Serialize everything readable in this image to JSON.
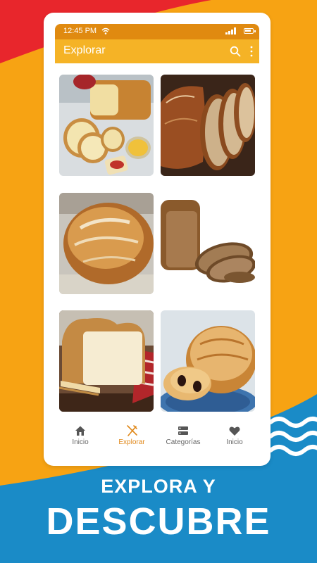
{
  "colors": {
    "background": "#f7a313",
    "red_corner": "#e8262c",
    "blue_band": "#1a8bc7",
    "statusbar": "#e08a10",
    "appbar": "#f5b326",
    "active_nav": "#e0881a"
  },
  "statusbar": {
    "time": "12:45 PM",
    "battery_level": 0.75
  },
  "appbar": {
    "title": "Explorar",
    "search_icon": "search-icon",
    "menu_icon": "more-vert-icon"
  },
  "grid": {
    "items": [
      {
        "image": "sliced-white-bread-with-butter-and-jam"
      },
      {
        "image": "sourdough-loaf-sliced"
      },
      {
        "image": "round-rustic-loaf"
      },
      {
        "image": "whole-wheat-bread-slices"
      },
      {
        "image": "sandwich-bread-loaf"
      },
      {
        "image": "turtle-shaped-bread"
      }
    ]
  },
  "navbar": {
    "items": [
      {
        "label": "Inicio",
        "icon": "home-icon"
      },
      {
        "label": "Explorar",
        "icon": "utensils-icon",
        "active": true
      },
      {
        "label": "Categorías",
        "icon": "categories-icon"
      },
      {
        "label": "Inicio",
        "icon": "heart-icon"
      }
    ]
  },
  "promo": {
    "line1": "EXPLORA Y",
    "line2": "DESCUBRE"
  }
}
